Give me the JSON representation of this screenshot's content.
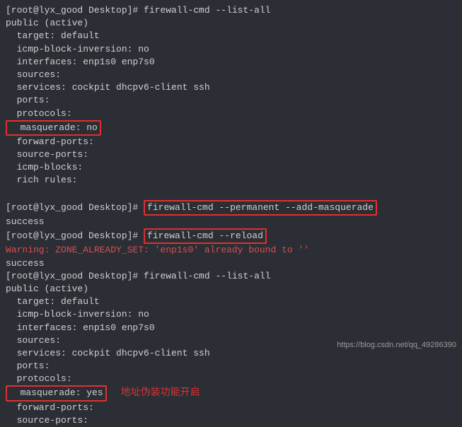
{
  "prompts": {
    "p1": "[root@lyx_good Desktop]# ",
    "cmd1": "firewall-cmd --list-all",
    "cmd2": "firewall-cmd --permanent --add-masquerade",
    "cmd3": "firewall-cmd --reload",
    "cmd4": "firewall-cmd --list-all"
  },
  "out1": {
    "l1": "public (active)",
    "l2": "  target: default",
    "l3": "  icmp-block-inversion: no",
    "l4": "  interfaces: enp1s0 enp7s0",
    "l5": "  sources:",
    "l6": "  services: cockpit dhcpv6-client ssh",
    "l7": "  ports:",
    "l8": "  protocols:",
    "masq": "  masquerade: no",
    "l10": "  forward-ports:",
    "l11": "  source-ports:",
    "l12": "  icmp-blocks:",
    "l13": "  rich rules:"
  },
  "success": "success",
  "warning": "Warning: ZONE_ALREADY_SET: 'enp1s0' already bound to ''",
  "out2": {
    "l1": "public (active)",
    "l2": "  target: default",
    "l3": "  icmp-block-inversion: no",
    "l4": "  interfaces: enp1s0 enp7s0",
    "l5": "  sources:",
    "l6": "  services: cockpit dhcpv6-client ssh",
    "l7": "  ports:",
    "l8": "  protocols:",
    "masq": "  masquerade: yes",
    "l10": "  forward-ports:",
    "l11": "  source-ports:"
  },
  "annotation": "地址伪装功能开启",
  "watermark": "https://blog.csdn.net/qq_49286390"
}
